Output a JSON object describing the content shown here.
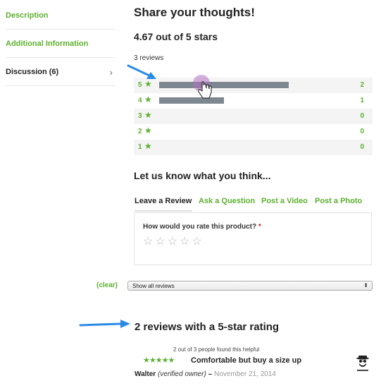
{
  "sidebar": {
    "items": [
      {
        "label": "Description"
      },
      {
        "label": "Additional Information"
      },
      {
        "label": "Discussion (6)"
      }
    ]
  },
  "main": {
    "share_title": "Share your thoughts!",
    "average": "4.67 out of 5 stars",
    "reviews_count": "3 reviews",
    "breakdown": [
      {
        "stars": "5",
        "count": "2",
        "fraction": 0.6667
      },
      {
        "stars": "4",
        "count": "1",
        "fraction": 0.3333
      },
      {
        "stars": "3",
        "count": "0",
        "fraction": 0
      },
      {
        "stars": "2",
        "count": "0",
        "fraction": 0
      },
      {
        "stars": "1",
        "count": "0",
        "fraction": 0
      }
    ],
    "letus_title": "Let us know what you think...",
    "tabs": [
      {
        "label": "Leave a Review"
      },
      {
        "label": "Ask a Question"
      },
      {
        "label": "Post a Video"
      },
      {
        "label": "Post a Photo"
      }
    ],
    "rate_question": "How would you rate this product?",
    "required_mark": "*",
    "empty_stars": "☆☆☆☆☆"
  },
  "filter": {
    "clear_label": "(clear)",
    "select_value": "Show all reviews"
  },
  "five_star": {
    "title": "2 reviews with a 5-star rating",
    "review": {
      "helpful": "2 out of 3 people found this helpful",
      "stars": "★★★★★",
      "title": "Comfortable but buy a size up",
      "author": "Walter",
      "owner": "(verified owner)",
      "dash": "–",
      "date": "November 21, 2014"
    }
  },
  "colors": {
    "accent_green": "#5db02f",
    "bar_gray": "#7d8790",
    "arrow_blue": "#2a8be6"
  },
  "icons": {
    "chevron": "chevron-right-icon",
    "star": "star-icon",
    "avatar": "heisenberg-avatar-icon",
    "cursor": "hand-pointer-cursor-icon"
  }
}
